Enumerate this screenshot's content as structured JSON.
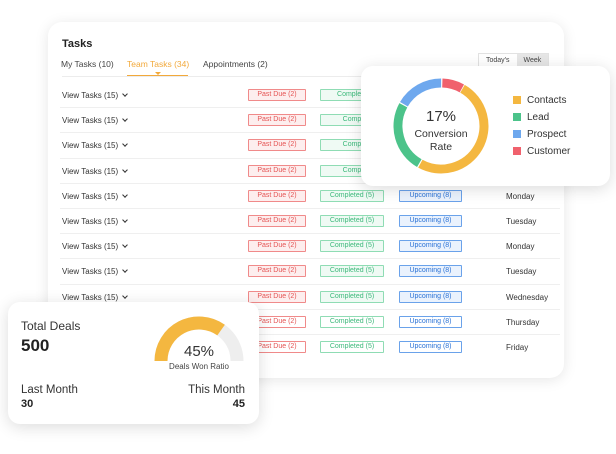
{
  "tasks": {
    "title": "Tasks",
    "tabs": [
      {
        "label": "My Tasks (10)",
        "active": false
      },
      {
        "label": "Team Tasks (34)",
        "active": true
      },
      {
        "label": "Appointments (2)",
        "active": false
      }
    ],
    "period_options": [
      "Today's",
      "Week"
    ],
    "selected_period": "Week",
    "rows": [
      {
        "label": "View Tasks (15)",
        "past_due": "Past Due (2)",
        "completed": "Complete",
        "upcoming": "",
        "day": ""
      },
      {
        "label": "View Tasks (15)",
        "past_due": "Past Due (2)",
        "completed": "Comp",
        "upcoming": "",
        "day": ""
      },
      {
        "label": "View Tasks (15)",
        "past_due": "Past Due (2)",
        "completed": "Comp",
        "upcoming": "",
        "day": ""
      },
      {
        "label": "View Tasks (15)",
        "past_due": "Past Due (2)",
        "completed": "Comp",
        "upcoming": "",
        "day": ""
      },
      {
        "label": "View Tasks (15)",
        "past_due": "Past Due (2)",
        "completed": "Completed (5)",
        "upcoming": "Upcoming (8)",
        "day": "Monday"
      },
      {
        "label": "View Tasks (15)",
        "past_due": "Past Due (2)",
        "completed": "Completed (5)",
        "upcoming": "Upcoming (8)",
        "day": "Tuesday"
      },
      {
        "label": "View Tasks (15)",
        "past_due": "Past Due (2)",
        "completed": "Completed (5)",
        "upcoming": "Upcoming (8)",
        "day": "Monday"
      },
      {
        "label": "View Tasks (15)",
        "past_due": "Past Due (2)",
        "completed": "Completed (5)",
        "upcoming": "Upcoming (8)",
        "day": "Tuesday"
      },
      {
        "label": "View Tasks (15)",
        "past_due": "Past Due (2)",
        "completed": "Completed (5)",
        "upcoming": "Upcoming (8)",
        "day": "Wednesday"
      },
      {
        "label": "",
        "past_due": "Past Due (2)",
        "completed": "Completed (5)",
        "upcoming": "Upcoming (8)",
        "day": "Thursday"
      },
      {
        "label": "",
        "past_due": "Past Due (2)",
        "completed": "Completed (5)",
        "upcoming": "Upcoming (8)",
        "day": "Friday"
      }
    ]
  },
  "conversion": {
    "percent": "17%",
    "label_line1": "Conversion",
    "label_line2": "Rate",
    "legend": [
      {
        "label": "Contacts",
        "color": "#f4b740"
      },
      {
        "label": "Lead",
        "color": "#4cc38a"
      },
      {
        "label": "Prospect",
        "color": "#6ea8ee"
      },
      {
        "label": "Customer",
        "color": "#f0616d"
      }
    ],
    "segments": [
      {
        "name": "Contacts",
        "fraction": 0.5
      },
      {
        "name": "Lead",
        "fraction": 0.25
      },
      {
        "name": "Prospect",
        "fraction": 0.17
      },
      {
        "name": "Customer",
        "fraction": 0.08
      }
    ]
  },
  "deals": {
    "title": "Total Deals",
    "total": "500",
    "won_percent": "45%",
    "won_fraction": 0.45,
    "won_label": "Deals Won Ratio",
    "last_month_label": "Last Month",
    "last_month_value": "30",
    "this_month_label": "This Month",
    "this_month_value": "45",
    "gauge_color": "#f4b740",
    "gauge_track": "#eeeeee"
  }
}
